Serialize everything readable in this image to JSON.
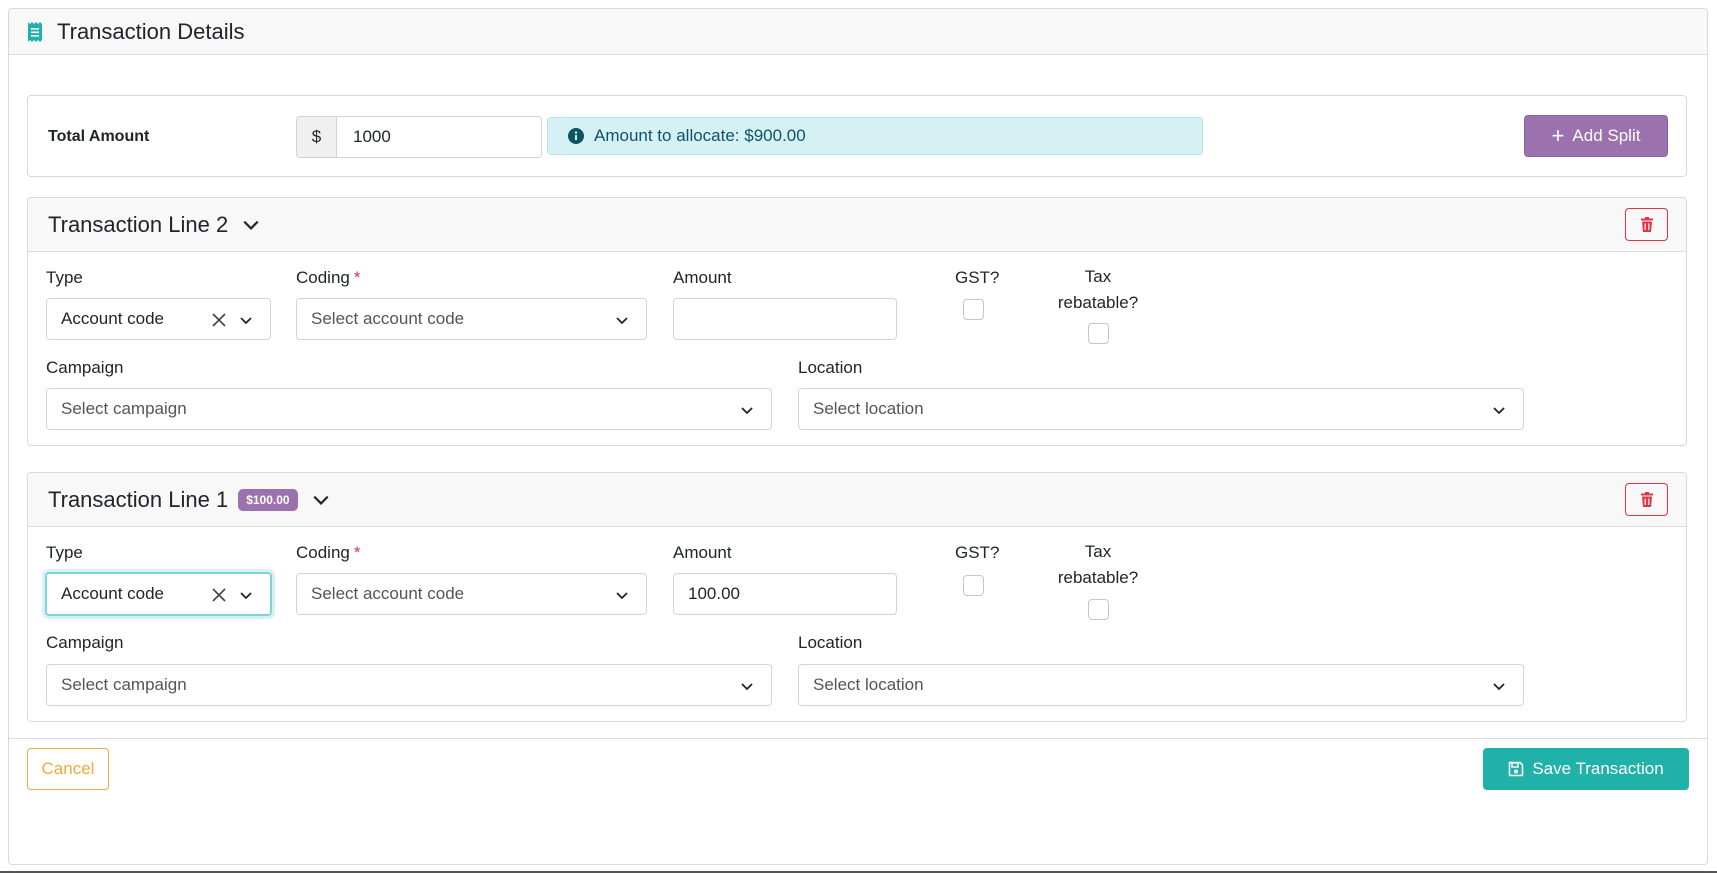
{
  "header": {
    "title": "Transaction Details",
    "icon": "receipt-icon"
  },
  "total": {
    "label": "Total Amount",
    "currency_prefix": "$",
    "amount_value": "1000",
    "allocate_text": "Amount to allocate: $900.00",
    "add_split_label": "Add Split"
  },
  "labels": {
    "type": "Type",
    "coding": "Coding",
    "required_mark": "*",
    "amount": "Amount",
    "gst": "GST?",
    "tax_rebatable": "Tax rebatable?",
    "campaign": "Campaign",
    "location": "Location"
  },
  "lines": [
    {
      "title": "Transaction Line 2",
      "badge": "",
      "type_value": "Account code",
      "coding_placeholder": "Select account code",
      "amount_value": "",
      "campaign_placeholder": "Select campaign",
      "location_placeholder": "Select location"
    },
    {
      "title": "Transaction Line 1",
      "badge": "$100.00",
      "type_value": "Account code",
      "coding_placeholder": "Select account code",
      "amount_value": "100.00",
      "campaign_placeholder": "Select campaign",
      "location_placeholder": "Select location"
    }
  ],
  "footer": {
    "cancel_label": "Cancel",
    "save_label": "Save Transaction"
  },
  "colors": {
    "accent_teal": "#20b2a9",
    "purple": "#9b72ad",
    "danger": "#dc3545",
    "warning": "#f0a93d",
    "info_bg": "#d6f1f4"
  }
}
